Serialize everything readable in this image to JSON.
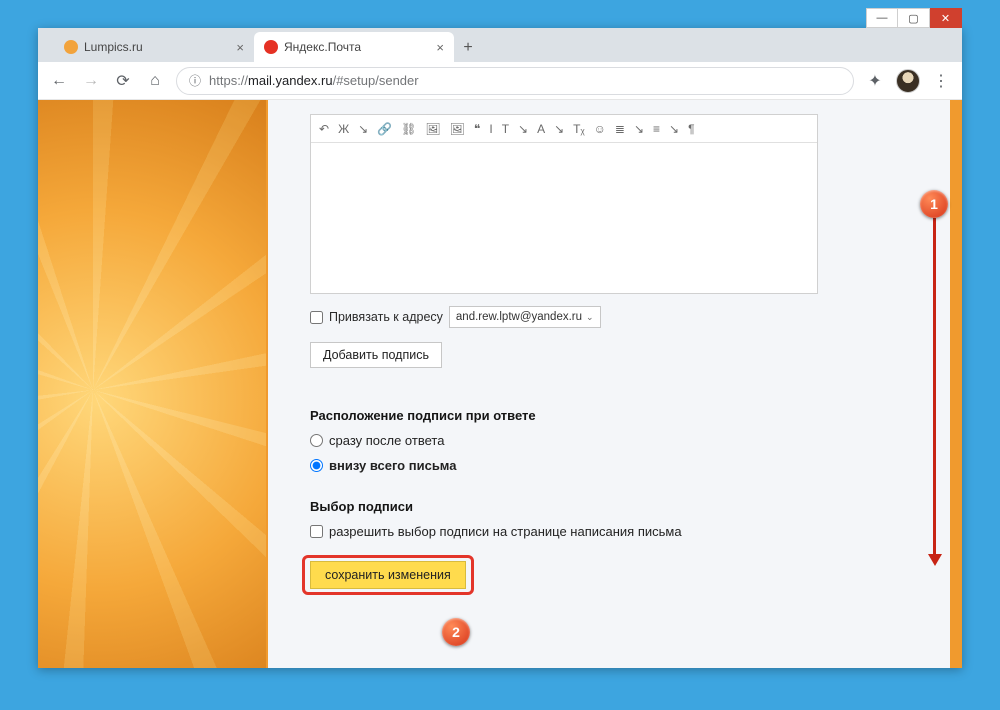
{
  "window_controls": {
    "minimize": "—",
    "maximize": "▢",
    "close": "✕"
  },
  "tabs": [
    {
      "title": "Lumpics.ru",
      "favicon_color": "#f2a33c",
      "active": false
    },
    {
      "title": "Яндекс.Почта",
      "favicon_color": "#e53124",
      "active": true
    }
  ],
  "new_tab_glyph": "+",
  "address_bar": {
    "scheme": "https://",
    "host": "mail.yandex.ru",
    "path": "/#setup/sender"
  },
  "editor_tools": [
    "↶",
    "Ж",
    "↘",
    "🔗",
    "⛓",
    "🖼",
    "🖼",
    "❝",
    "I",
    "T",
    "↘",
    "A",
    "↘",
    "Tᵪ",
    "☺",
    "≣",
    "↘",
    "≡",
    "↘",
    "¶"
  ],
  "bind_address": {
    "label": "Привязать к адресу",
    "value": "and.rew.lptw@yandex.ru"
  },
  "add_signature_btn": "Добавить подпись",
  "sig_position": {
    "heading": "Расположение подписи при ответе",
    "options": [
      {
        "label": "сразу после ответа",
        "selected": false
      },
      {
        "label": "внизу всего письма",
        "selected": true
      }
    ]
  },
  "sig_choice": {
    "heading": "Выбор подписи",
    "checkbox_label": "разрешить выбор подписи на странице написания письма"
  },
  "save_btn": "сохранить изменения",
  "annotations": {
    "marker1": "1",
    "marker2": "2"
  }
}
